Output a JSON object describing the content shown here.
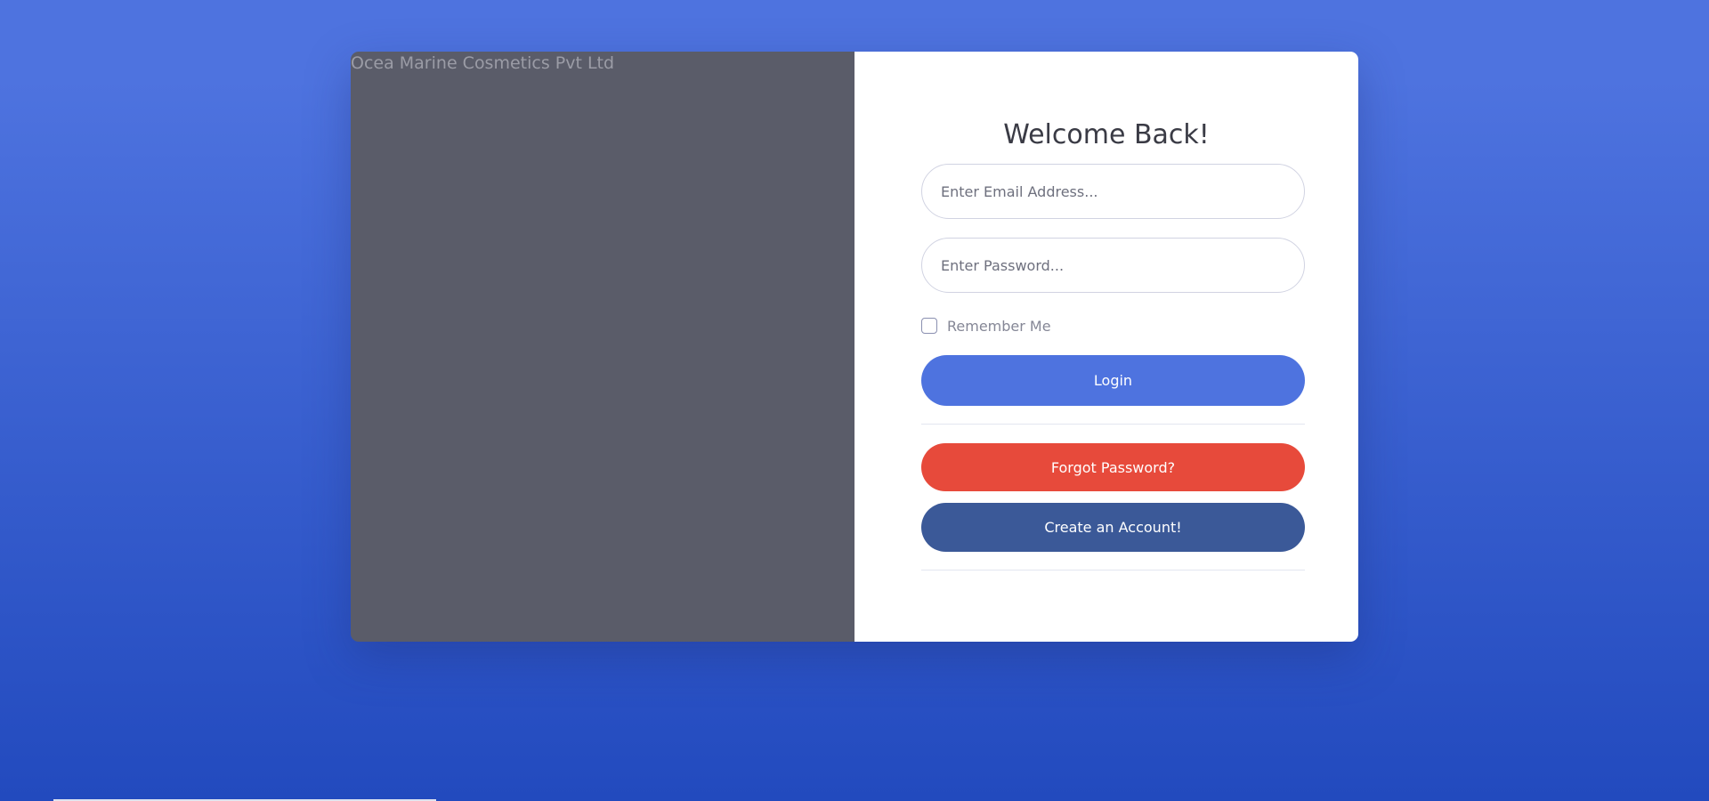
{
  "brand_panel": {
    "image_alt": "Ocea Marine Cosmetics Pvt Ltd"
  },
  "form": {
    "title": "Welcome Back!",
    "email_placeholder": "Enter Email Address...",
    "email_value": "",
    "password_placeholder": "Enter Password...",
    "password_value": "",
    "remember_label": "Remember Me",
    "remember_checked": false,
    "login_label": "Login",
    "forgot_label": "Forgot Password?",
    "create_label": "Create an Account!"
  },
  "colors": {
    "primary": "#4e73df",
    "danger": "#e74a3b",
    "facebook_blue": "#3b5998",
    "image_panel": "#5a5c69"
  }
}
